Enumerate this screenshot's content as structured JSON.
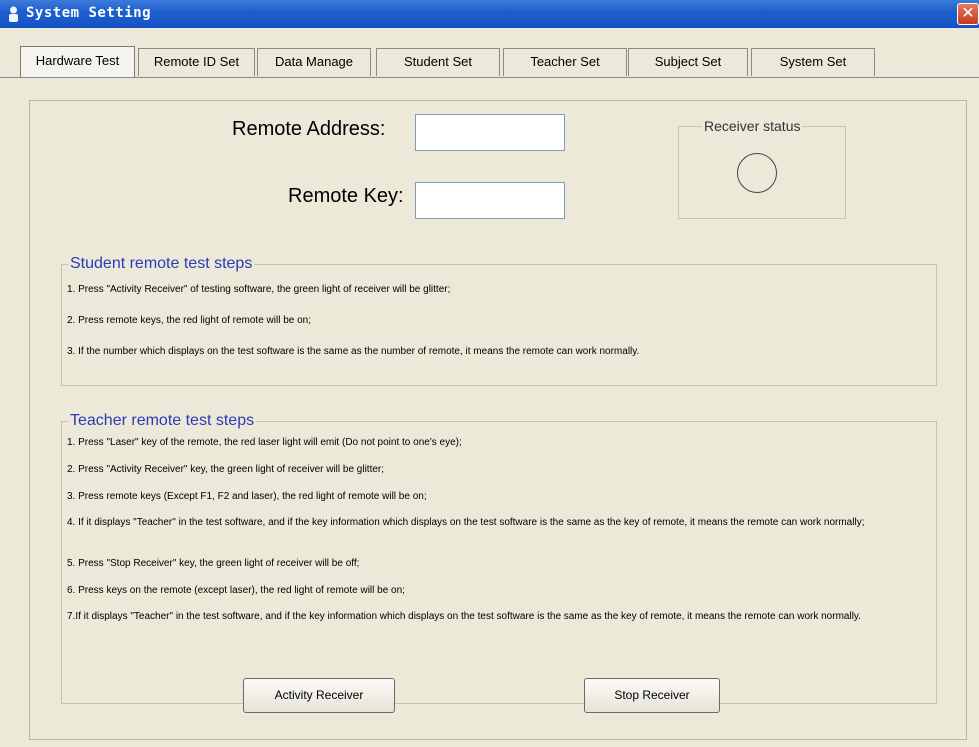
{
  "window": {
    "title": "System Setting",
    "close_glyph": "✕"
  },
  "tabs": [
    {
      "label": "Hardware Test",
      "active": true
    },
    {
      "label": "Remote ID Set"
    },
    {
      "label": "Data Manage"
    },
    {
      "label": "Student Set"
    },
    {
      "label": "Teacher Set"
    },
    {
      "label": "Subject Set"
    },
    {
      "label": "System Set"
    }
  ],
  "form": {
    "remote_address_label": "Remote Address:",
    "remote_address_value": "",
    "remote_key_label": "Remote Key:",
    "remote_key_value": ""
  },
  "receiver_status": {
    "title": "Receiver status"
  },
  "student_steps": {
    "title": "Student remote test steps",
    "items": [
      "1. Press \"Activity Receiver\" of testing software, the green light of receiver will be glitter;",
      "2. Press remote keys, the red light of remote will be on;",
      "3. If the number which displays on the test software is the same as the number of remote, it means the remote can work normally."
    ]
  },
  "teacher_steps": {
    "title": "Teacher remote test steps",
    "items": [
      "1. Press \"Laser\" key of the remote, the red laser light will emit (Do not point to one's eye);",
      "2. Press \"Activity Receiver\" key, the green light of receiver will be glitter;",
      "3. Press remote keys (Except F1, F2 and laser), the red light of remote will be on;",
      "4. If it displays \"Teacher\" in the test software, and if the key information which displays on the test software is the same as the key of remote, it means the remote can work normally;",
      "5. Press \"Stop Receiver\" key, the green light of receiver will be off;",
      "6. Press keys on the remote (except laser), the red light of remote will be on;",
      "7.If it displays \"Teacher\" in the test software, and if the key information which displays on the test software is the same as the key of remote, it means the remote can work normally."
    ]
  },
  "buttons": {
    "activity_receiver": "Activity Receiver",
    "stop_receiver": "Stop Receiver"
  },
  "colors": {
    "titlebar": "#1e5fd0",
    "group_title": "#2a3ab8",
    "face": "#ece9d8"
  }
}
